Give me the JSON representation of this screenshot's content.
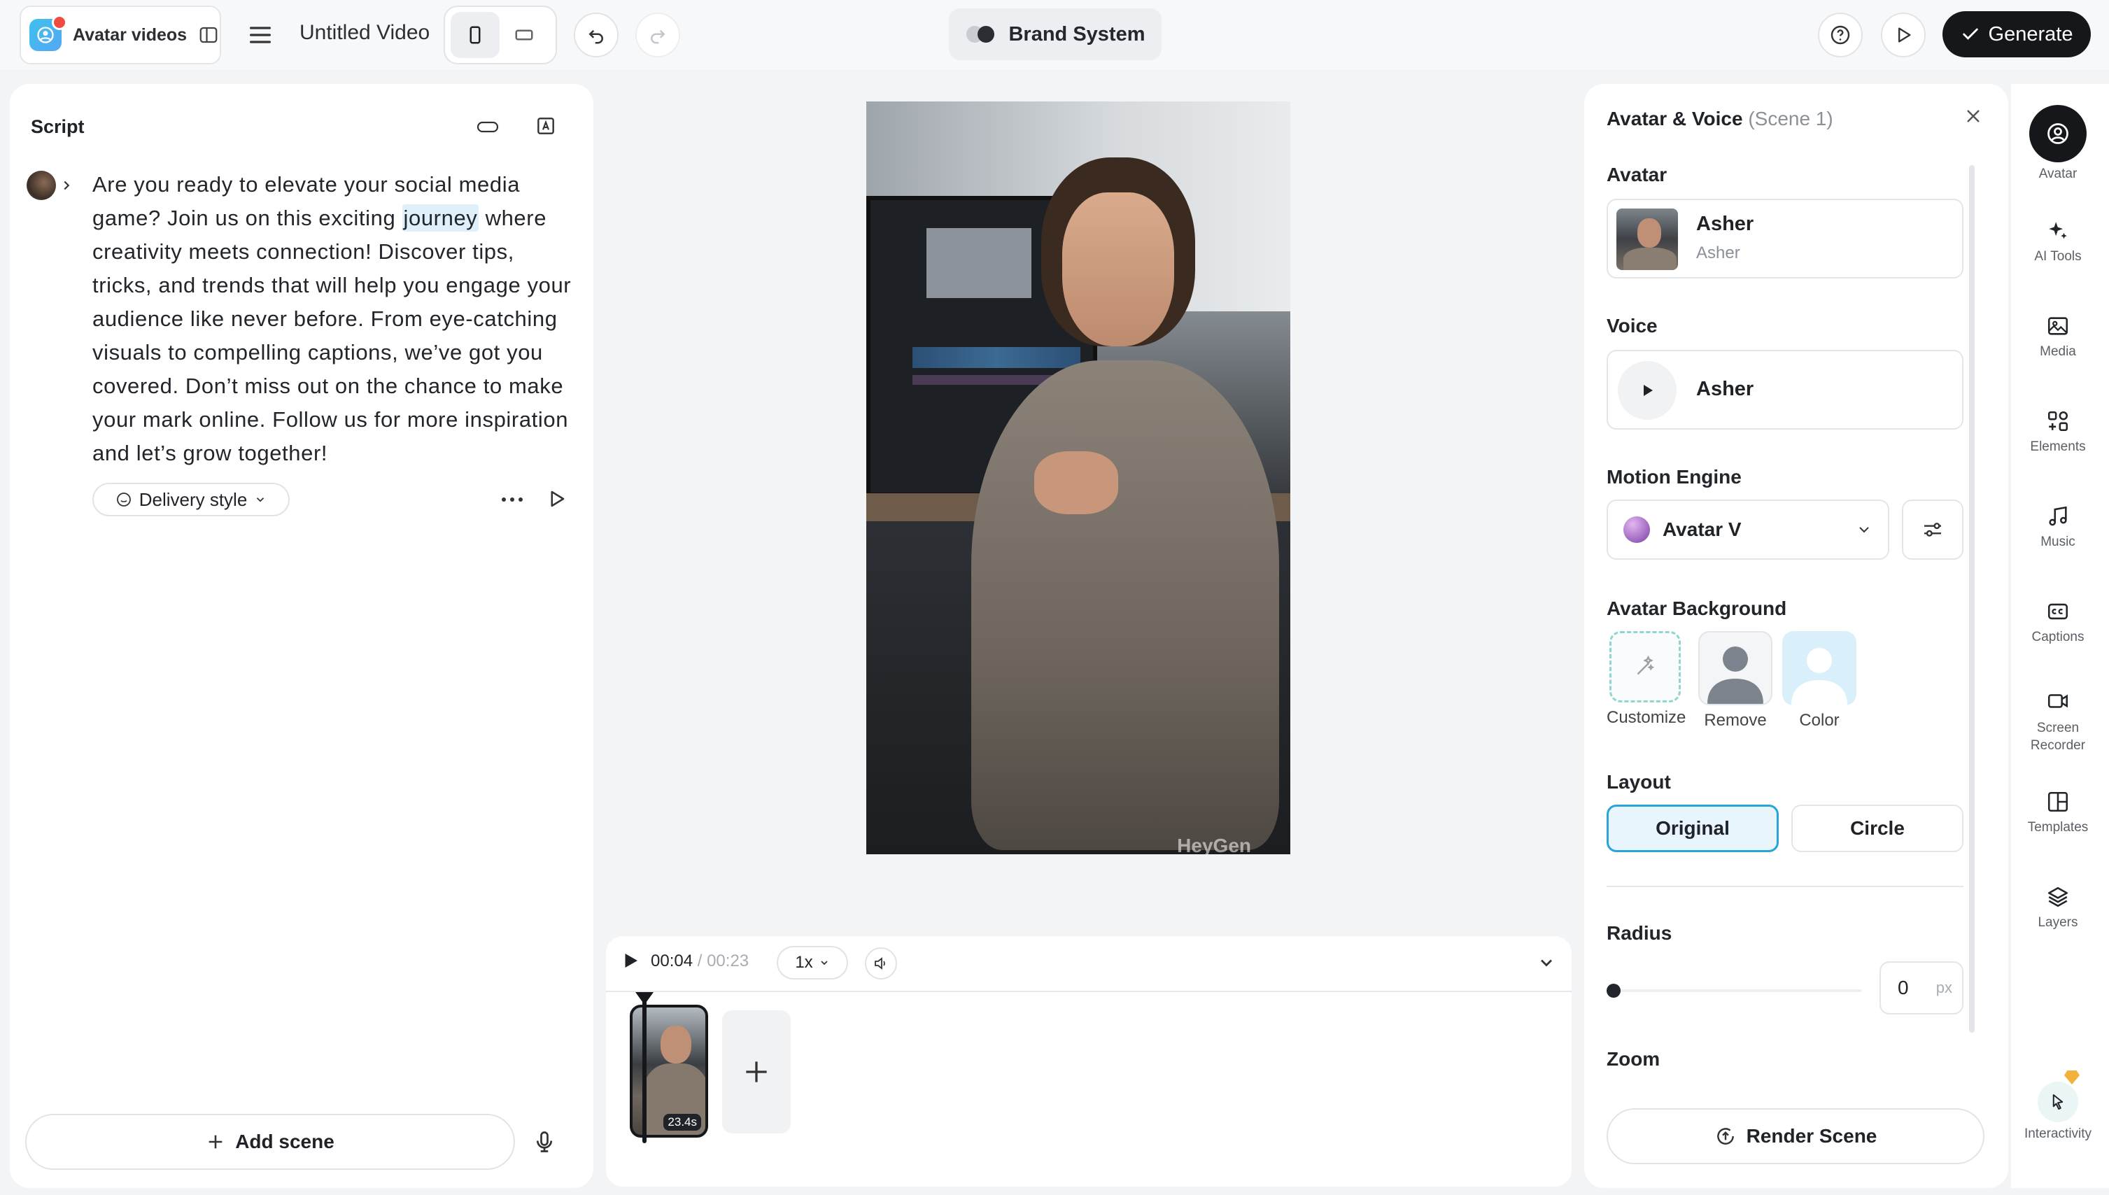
{
  "topbar": {
    "app_name": "Avatar videos",
    "video_title": "Untitled Video",
    "brand_system": "Brand System",
    "generate_label": "Generate"
  },
  "script": {
    "title": "Script",
    "text_before": "Are you ready to elevate your social media game? Join us on this exciting ",
    "highlight": "journey",
    "text_after": " where creativity meets connection! Discover tips, tricks, and trends that will help you engage your audience like never before. From eye-catching visuals to compelling captions, we’ve got you covered. Don’t miss out on the chance to make your mark online. Follow us for more inspiration and let’s grow together!",
    "delivery_style": "Delivery style",
    "add_scene": "Add scene"
  },
  "preview": {
    "watermark": "HeyGen"
  },
  "timeline": {
    "current_time": "00:04",
    "separator": "/",
    "total_time": "00:23",
    "speed": "1x",
    "clip_duration": "23.4s"
  },
  "inspector": {
    "title": "Avatar & Voice",
    "scene_tag": "(Scene 1)",
    "avatar_section": "Avatar",
    "avatar_name": "Asher",
    "avatar_sub": "Asher",
    "voice_section": "Voice",
    "voice_name": "Asher",
    "motion_section": "Motion Engine",
    "motion_value": "Avatar V",
    "background_section": "Avatar Background",
    "bg_options": [
      "Customize",
      "Remove",
      "Color"
    ],
    "layout_section": "Layout",
    "layout_original": "Original",
    "layout_circle": "Circle",
    "radius_section": "Radius",
    "radius_value": "0",
    "radius_unit": "px",
    "zoom_section": "Zoom",
    "render_scene": "Render Scene"
  },
  "rail": {
    "items": [
      "Avatar",
      "AI Tools",
      "Media",
      "Elements",
      "Music",
      "Captions",
      "Screen Recorder",
      "Templates",
      "Layers",
      "Interactivity"
    ]
  },
  "colors": {
    "accent": "#2aa3d8",
    "generate_bg": "#15171a",
    "selected_layout_bg": "#e8f5fc"
  }
}
